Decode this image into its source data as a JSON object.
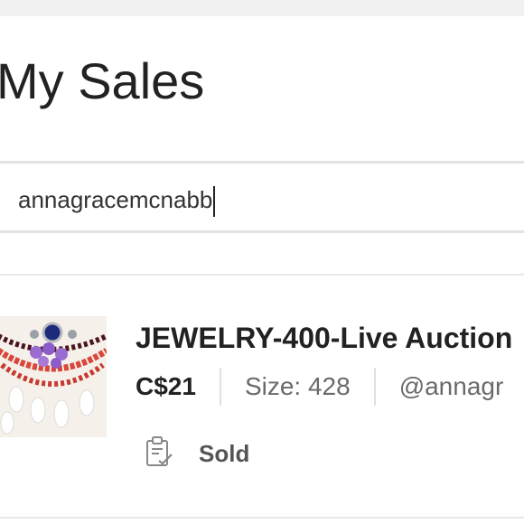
{
  "header": {
    "title": "My Sales"
  },
  "search": {
    "value": "annagracemcnabb"
  },
  "listing": {
    "title": "JEWELRY-400-Live Auction",
    "price": "C$21",
    "size": "Size: 428",
    "seller": "@annagr",
    "status": "Sold",
    "status_icon": "clipboard-check-icon",
    "thumbnail": "jewelry-necklace-photo"
  }
}
